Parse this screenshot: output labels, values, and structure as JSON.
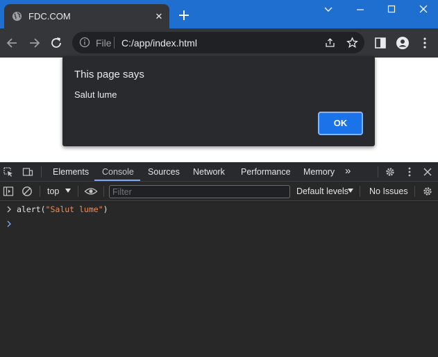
{
  "browser": {
    "tab_title": "FDC.COM",
    "tab_close": "✕",
    "address": {
      "scheme_label": "File",
      "url": "C:/app/index.html"
    }
  },
  "dialog": {
    "title": "This page says",
    "message": "Salut lume",
    "ok_label": "OK"
  },
  "devtools": {
    "tabs": [
      "Elements",
      "Console",
      "Sources",
      "Network",
      "Performance",
      "Memory"
    ],
    "active_tab": "Console",
    "more_tabs": "»",
    "context": "top",
    "filter_placeholder": "Filter",
    "levels_label": "Default levels",
    "issues_label": "No Issues",
    "console": {
      "command_prefix": "alert(",
      "command_string": "\"Salut lume\"",
      "command_suffix": ")"
    }
  },
  "colors": {
    "titlebar": "#1f6fd1",
    "ok_button": "#1a73e8",
    "active_tab_underline": "#7cacf8",
    "string_literal": "#f28b54"
  }
}
